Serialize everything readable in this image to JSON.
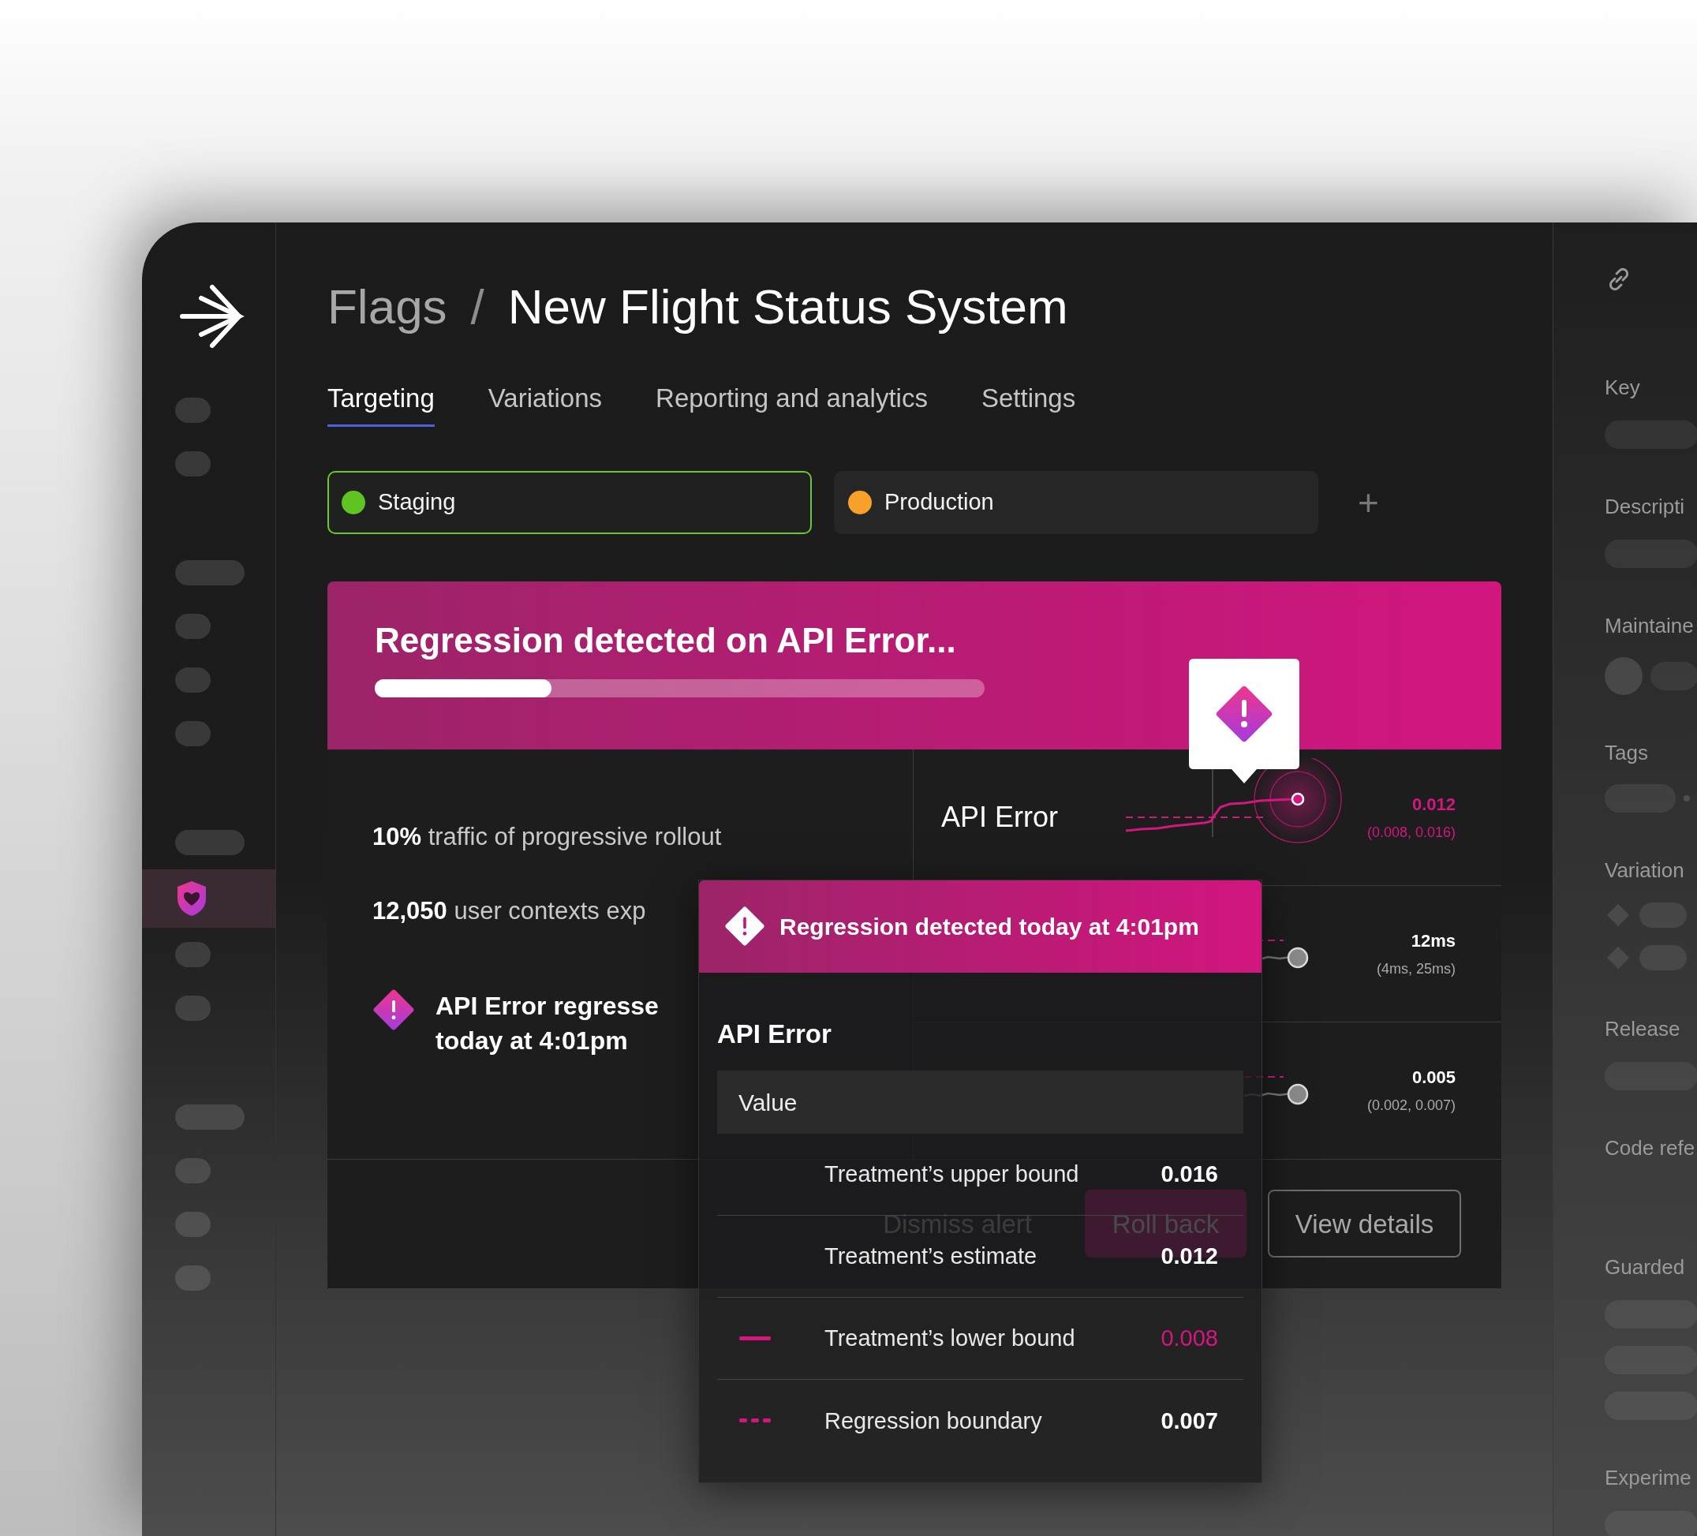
{
  "nav_groups": [
    {
      "items": [
        {
          "kind": "short",
          "selected": false
        },
        {
          "kind": "short",
          "selected": false
        }
      ]
    },
    {
      "items": [
        {
          "kind": "long",
          "selected": false
        },
        {
          "kind": "short",
          "selected": false
        },
        {
          "kind": "short",
          "selected": false
        },
        {
          "kind": "short",
          "selected": false
        }
      ]
    },
    {
      "items": [
        {
          "kind": "long",
          "selected": false
        },
        {
          "kind": "shield",
          "selected": true
        },
        {
          "kind": "short",
          "selected": false
        },
        {
          "kind": "short",
          "selected": false
        }
      ]
    },
    {
      "items": [
        {
          "kind": "long",
          "selected": false
        },
        {
          "kind": "short",
          "selected": false
        },
        {
          "kind": "short",
          "selected": false
        },
        {
          "kind": "short",
          "selected": false
        }
      ]
    }
  ],
  "breadcrumb": {
    "parent": "Flags",
    "separator": "/",
    "current": "New Flight Status System"
  },
  "tabs": [
    {
      "label": "Targeting",
      "selected": true
    },
    {
      "label": "Variations",
      "selected": false
    },
    {
      "label": "Reporting and analytics",
      "selected": false
    },
    {
      "label": "Settings",
      "selected": false
    }
  ],
  "environments": [
    {
      "label": "Staging",
      "color": "#5ec422",
      "selected": true
    },
    {
      "label": "Production",
      "color": "#f7a12a",
      "selected": false
    }
  ],
  "add_environment": "+",
  "alert": {
    "title": "Regression detected on API Error...",
    "progress": {
      "level": 0.29
    },
    "rollout_text": "**10%** traffic of progressive rollout",
    "contexts_text": "**12,050** user contexts exp",
    "note_lines": [
      "API Error regresse",
      "today at 4:01pm"
    ],
    "metrics": [
      {
        "name": "API Error",
        "value": "0.012",
        "interval": "(0.008, 0.016)",
        "regressed": true
      },
      {
        "value": "12ms",
        "interval": "(4ms, 25ms)",
        "regressed": false
      },
      {
        "value": "0.005",
        "interval": "(0.002, 0.007)",
        "regressed": false
      }
    ],
    "buttons": [
      {
        "label": "Dismiss alert",
        "kind": "link"
      },
      {
        "label": "Roll back",
        "kind": "danger"
      },
      {
        "label": "View details",
        "kind": "outline"
      }
    ]
  },
  "popup": {
    "title": "Regression detected today at 4:01pm",
    "metric": "API Error",
    "column": "Value",
    "rows": [
      {
        "kind": "plain",
        "label": "Treatment’s upper bound",
        "value": "0.016",
        "highlighted": false
      },
      {
        "kind": "plain",
        "label": "Treatment’s estimate",
        "value": "0.012",
        "highlighted": false
      },
      {
        "kind": "solid",
        "label": "Treatment’s lower bound",
        "value": "0.008",
        "highlighted": true
      },
      {
        "kind": "dashed",
        "label": "Regression boundary",
        "value": "0.007",
        "highlighted": false
      }
    ]
  },
  "details": {
    "fields": [
      {
        "label": "Key",
        "kind": "bar"
      },
      {
        "label": "Descripti",
        "kind": "bar"
      },
      {
        "label": "Maintaine",
        "kind": "avatar"
      },
      {
        "label": "Tags",
        "kind": "tags"
      },
      {
        "label": "Variation",
        "kind": "variations"
      },
      {
        "label": "Release",
        "kind": "bar"
      },
      {
        "label": "Code refe",
        "kind": "none"
      },
      {
        "label": "Guarded",
        "kind": "bars"
      },
      {
        "label": "Experime",
        "kind": "bar"
      }
    ]
  }
}
